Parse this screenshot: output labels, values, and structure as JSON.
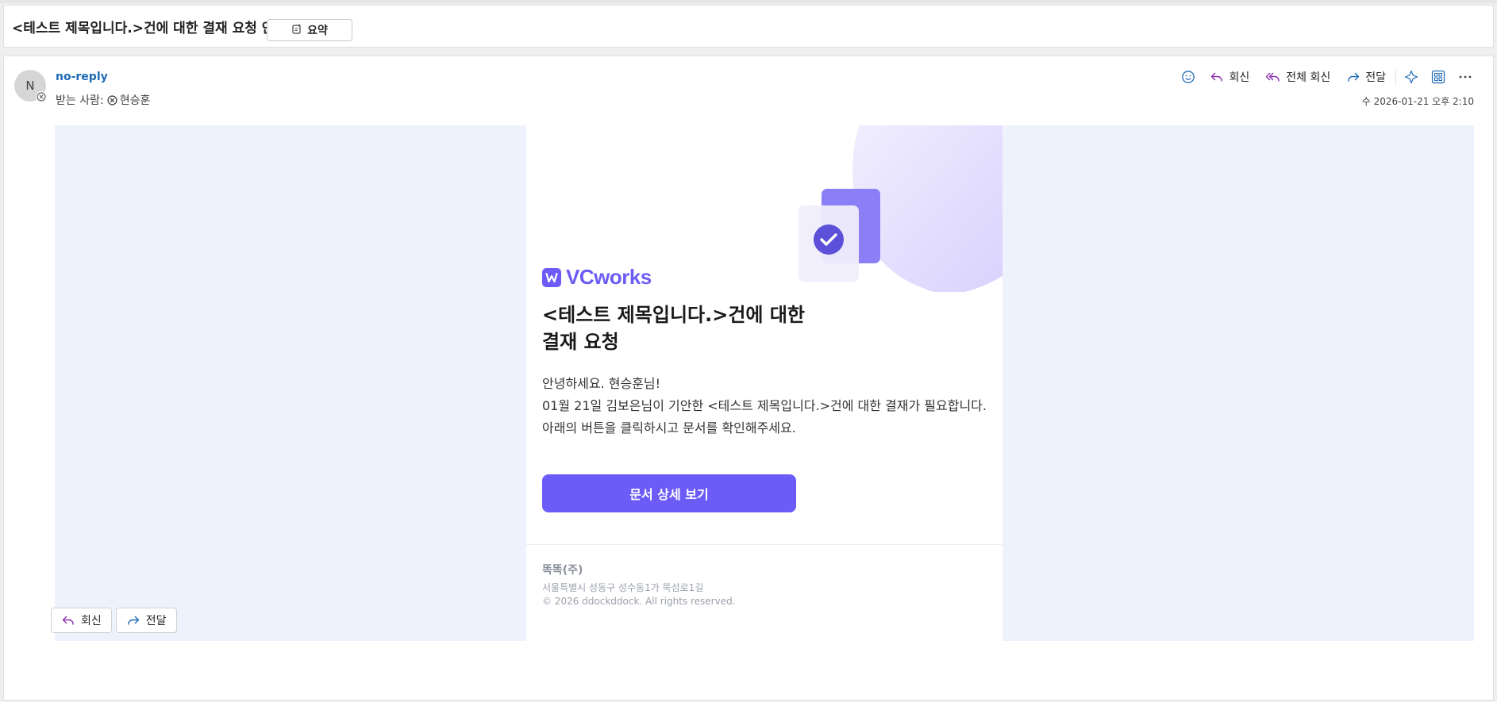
{
  "subject": {
    "title": "<테스트 제목입니다.>건에 대한 결재 요청 안내",
    "summary_label": "요약"
  },
  "message": {
    "avatar_initial": "N",
    "sender": "no-reply",
    "recipients_label": "받는 사람:",
    "recipient": "현승훈",
    "date": "수 2026-01-21 오후 2:10",
    "actions": {
      "reply": "회신",
      "reply_all": "전체 회신",
      "forward": "전달"
    },
    "icons": [
      "emoji-icon",
      "reply-icon",
      "reply-all-icon",
      "forward-icon",
      "sparkle-icon",
      "apps-icon",
      "more-icon"
    ]
  },
  "email": {
    "brand": "VCworks",
    "headline_line1": "<테스트 제목입니다.>건에 대한",
    "headline_line2": "결재 요청",
    "greeting": "안녕하세요. 현승훈님!",
    "body_line": "01월 21일 김보은님이 기안한 <테스트 제목입니다.>건에 대한 결재가 필요합니다.",
    "body_line2": "아래의 버튼을 클릭하시고 문서를 확인해주세요.",
    "cta_label": "문서 상세 보기",
    "company": "똑똑(주)",
    "address": "서울특별시 성동구 성수동1가 뚝섬로1길",
    "copyright": "© 2026 ddockddock. All rights reserved."
  },
  "footer": {
    "reply": "회신",
    "forward": "전달"
  },
  "colors": {
    "accent": "#6b5cf7",
    "sender": "#1e6ab5",
    "email_bg": "#eef2fd",
    "reply_icon": "#8a2fae",
    "forward_icon": "#1e6ab5"
  }
}
